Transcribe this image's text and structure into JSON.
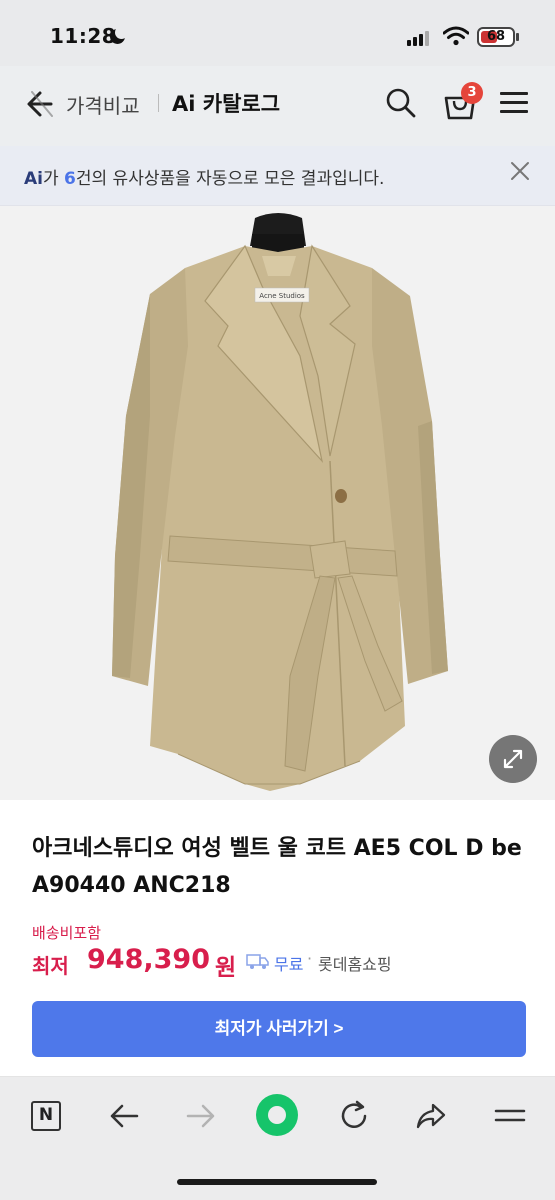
{
  "status_bar": {
    "time": "11:28",
    "battery": "68"
  },
  "header": {
    "breadcrumb_prev": "가격비교",
    "breadcrumb_current": "Ai 카탈로그",
    "cart_count": "3"
  },
  "banner": {
    "ai_mark": "Ai",
    "text_pre": "가 ",
    "count": "6",
    "text_post": "건의 유사상품을 자동으로 모은 결과입니다."
  },
  "product": {
    "image_label": "Acne Studios",
    "title": "아크네스튜디오 여성 벨트 울 코트 AE5 COL D be A90440 ANC218",
    "shipping_note": "배송비포함",
    "price_label": "최저",
    "price": "948,390",
    "price_unit": "원",
    "free_shipping": "무료",
    "separator": "·",
    "seller": "롯데홈쇼핑",
    "cta_label": "최저가 사러가기 >"
  },
  "colors": {
    "accent": "#4e78ea",
    "price": "#d81e4c",
    "badge": "#e5453b",
    "naver_green": "#16c46a"
  },
  "icons": {
    "back": "back-arrow-icon",
    "search": "search-icon",
    "cart": "cart-icon",
    "menu": "hamburger-menu-icon",
    "close": "close-icon",
    "expand": "expand-icon",
    "truck": "truck-icon",
    "toolbar": [
      "naver-n-icon",
      "back-arrow-icon",
      "forward-arrow-icon",
      "green-dot-icon",
      "refresh-icon",
      "share-icon",
      "menu-icon"
    ]
  }
}
